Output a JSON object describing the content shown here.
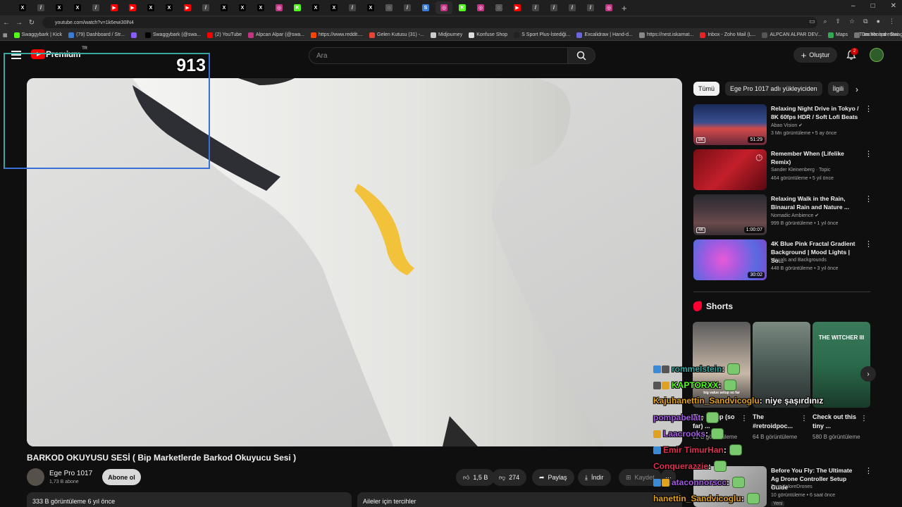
{
  "browser": {
    "tabs": [
      {
        "letter": "X",
        "color": "#000000",
        "active": false
      },
      {
        "letter": "/",
        "color": "#444444",
        "active": false
      },
      {
        "letter": "X",
        "color": "#000000",
        "active": false
      },
      {
        "letter": "X",
        "color": "#000000",
        "active": false
      },
      {
        "letter": "/",
        "color": "#444444",
        "active": false
      },
      {
        "letter": "▶",
        "color": "#ff0000",
        "active": false
      },
      {
        "letter": "▶",
        "color": "#ff0000",
        "active": false
      },
      {
        "letter": "X",
        "color": "#000000",
        "active": false
      },
      {
        "letter": "X",
        "color": "#000000",
        "active": false
      },
      {
        "letter": "▶",
        "color": "#ff0000",
        "active": false
      },
      {
        "letter": "/",
        "color": "#444444",
        "active": false
      },
      {
        "letter": "X",
        "color": "#000000",
        "active": false
      },
      {
        "letter": "X",
        "color": "#000000",
        "active": false
      },
      {
        "letter": "X",
        "color": "#000000",
        "active": false
      },
      {
        "letter": "◎",
        "color": "#c13584",
        "active": false
      },
      {
        "letter": "K",
        "color": "#53fc18",
        "active": false
      },
      {
        "letter": "X",
        "color": "#000000",
        "active": false
      },
      {
        "letter": "X",
        "color": "#000000",
        "active": false
      },
      {
        "letter": "/",
        "color": "#444444",
        "active": false
      },
      {
        "letter": "X",
        "color": "#000000",
        "active": false
      },
      {
        "letter": "◌",
        "color": "#555555",
        "active": false
      },
      {
        "letter": "/",
        "color": "#444444",
        "active": false
      },
      {
        "letter": "S",
        "color": "#3a7bd5",
        "active": false
      },
      {
        "letter": "◎",
        "color": "#c13584",
        "active": true
      },
      {
        "letter": "K",
        "color": "#53fc18",
        "active": false
      },
      {
        "letter": "◎",
        "color": "#c13584",
        "active": false
      },
      {
        "letter": "◌",
        "color": "#555555",
        "active": false
      },
      {
        "letter": "▶",
        "color": "#ff0000",
        "active": false
      },
      {
        "letter": "/",
        "color": "#444444",
        "active": false
      },
      {
        "letter": "/",
        "color": "#444444",
        "active": false
      },
      {
        "letter": "/",
        "color": "#444444",
        "active": false
      },
      {
        "letter": "/",
        "color": "#444444",
        "active": false
      },
      {
        "letter": "◎",
        "color": "#c13584",
        "active": false
      }
    ],
    "new_tab": "+",
    "window_controls": [
      "–",
      "□",
      "✕"
    ],
    "url": "youtube.com/watch?v=1k6ewi30lN4",
    "bookmarks": [
      {
        "label": "Swaggybark | Kick",
        "color": "#53fc18"
      },
      {
        "label": "(79) Dashboard / Str...",
        "color": "#3a7bd5"
      },
      {
        "label": "",
        "color": "#8a5cf6"
      },
      {
        "label": "Swaggybark (@swa...",
        "color": "#000000"
      },
      {
        "label": "(2) YouTube",
        "color": "#ff0000"
      },
      {
        "label": "Alpcan Alpar (@swa...",
        "color": "#c13584"
      },
      {
        "label": "https://www.reddit....",
        "color": "#ff4500"
      },
      {
        "label": "Gelen Kutusu (31) -...",
        "color": "#ea4335"
      },
      {
        "label": "Midjourney",
        "color": "#cccccc"
      },
      {
        "label": "Konfuse Shop",
        "color": "#dddddd"
      },
      {
        "label": "S Sport Plus-İstediği...",
        "color": "#222222"
      },
      {
        "label": "Excalidraw | Hand-d...",
        "color": "#6965db"
      },
      {
        "label": "https://nest.iskarnat...",
        "color": "#888888"
      },
      {
        "label": "Inbox - Zoho Mail (L...",
        "color": "#e42527"
      },
      {
        "label": "ALPCAN ALPAR DEV...",
        "color": "#555555"
      },
      {
        "label": "Maps",
        "color": "#34a853"
      },
      {
        "label": "Dashboard - Swagg...",
        "color": "#777777"
      }
    ],
    "bookmarks_all": "Tüm Yer İşaretleri"
  },
  "header": {
    "logo_text": "Premium",
    "logo_region": "TR",
    "search_placeholder": "Ara",
    "create_label": "Oluştur",
    "notification_count": "2"
  },
  "overlay": {
    "counter": "913"
  },
  "video": {
    "title": "BARKOD OKUYUSU SESİ ( Bip Marketlerde Barkod Okuyucu Sesi )",
    "channel_name": "Ege Pro 1017",
    "subscribers": "1,73 B abone",
    "subscribe_label": "Abone ol",
    "likes": "1,5 B",
    "dislikes": "274",
    "share_label": "Paylaş",
    "download_label": "İndir",
    "save_label": "Kaydet",
    "more_label": "···",
    "views_date": "333 B görüntüleme  6 yıl önce",
    "family_label": "Aileler için tercihler"
  },
  "sidebar": {
    "chips": [
      {
        "label": "Tümü",
        "active": true
      },
      {
        "label": "Ege Pro 1017 adlı yükleyiciden",
        "active": false
      },
      {
        "label": "İlgili",
        "active": false
      }
    ],
    "recommendations": [
      {
        "title": "Relaxing Night Drive in Tokyo / 8K 60fps HDR / Soft Lofi Beats",
        "channel": "Abao Vision ✔",
        "meta": "3 Mn görüntüleme • 5 ay önce",
        "duration": "51:29",
        "badge": "8K",
        "thumb_bg": "linear-gradient(180deg,#1a2a5a 0%,#3a4f8f 45%,#d24a4a 60%,#6a2a3a 100%)"
      },
      {
        "title": "Remember When (Lifelike Remix)",
        "channel": "Sander Kleinenberg · Topic",
        "meta": "464 görüntüleme • 5 yıl önce",
        "duration": "",
        "badge": "",
        "thumb_bg": "linear-gradient(135deg,#7a0d15 0%,#c21f2a 50%,#5a0810 100%)"
      },
      {
        "title": "Relaxing Walk in the Rain, Binaural Rain and Nature ...",
        "channel": "Nomadic Ambience ✔",
        "meta": "999 B görüntüleme • 1 yıl önce",
        "duration": "1:00:07",
        "badge": "4K",
        "thumb_bg": "linear-gradient(180deg,#2a2a30 0%,#4a3a40 40%,#6a4a4a 70%,#3a3035 100%)"
      },
      {
        "title": "4K Blue Pink Fractal Gradient Background | Mood Lights | So...",
        "channel": "Visuals and Backgrounds",
        "meta": "448 B görüntüleme • 3 yıl önce",
        "duration": "30:02",
        "badge": "",
        "thumb_bg": "radial-gradient(circle at 40% 50%,#e85ad8 0%,#a35ae0 35%,#5a6ae0 70%,#7a4ad0 100%)"
      }
    ],
    "shorts_heading": "Shorts",
    "shorts": [
      {
        "title": "The Setup (so far) ...",
        "views": "22 B görüntüleme",
        "thumb_bg": "linear-gradient(180deg,#5a5a5a 0%,#c8b8a8 60%,#3a3a3a 100%)"
      },
      {
        "title": "The #retroidpoc...",
        "views": "64 B görüntüleme",
        "thumb_bg": "linear-gradient(180deg,#7a8a80 0%,#4a5a55 50%,#2a3030 100%)"
      },
      {
        "title": "Check out this tiny ...",
        "views": "580 B görüntüleme",
        "thumb_bg": "linear-gradient(180deg,#3a7a5a 0%,#2a6a4a 50%,#1a3a2a 100%)"
      }
    ],
    "shorts_overlay_texts": [
      "big value setup so far",
      "",
      "THE WITCHER III"
    ],
    "bottom_rec": {
      "title": "Before You Fly: The Ultimate Ag Drone Controller Setup Guide",
      "channel": "TerraXploreDrones",
      "meta": "10 görüntüleme • 6 saat önce",
      "badge": "Yeni",
      "thumb_bg": "linear-gradient(135deg,#c8c8c8 0%,#8a8a8a 100%)"
    }
  },
  "chat": [
    {
      "user": "rommelstein",
      "color": "#3aa6a0",
      "message": "",
      "emote": true,
      "badges": [
        "#3a8ad8",
        "#555555"
      ]
    },
    {
      "user": "KAPTORXX",
      "color": "#53fc18",
      "message": "",
      "emote": true,
      "badges": [
        "#555555",
        "#e0a020"
      ]
    },
    {
      "user": "Kajuhanettin_Sandvicoglu",
      "color": "#e0a020",
      "message": "niye şaşırdınız",
      "emote": false,
      "badges": []
    },
    {
      "user": "pompabelat",
      "color": "#a35ae0",
      "message": "",
      "emote": true,
      "badges": []
    },
    {
      "user": "Laacrooks",
      "color": "#a35ae0",
      "message": "",
      "emote": true,
      "badges": [
        "#e0a020"
      ]
    },
    {
      "user": "Emir TimurHan",
      "color": "#e03050",
      "message": "",
      "emote": true,
      "badges": [
        "#3a8ad8"
      ]
    },
    {
      "user": "Conquerazzie",
      "color": "#e03050",
      "message": "",
      "emote": true,
      "badges": []
    },
    {
      "user": "ataconnorscc",
      "color": "#a35ae0",
      "message": "",
      "emote": true,
      "badges": [
        "#3a8ad8",
        "#e0a020"
      ]
    },
    {
      "user": "hanettin_Sandvicoglu",
      "color": "#e0a020",
      "message": "",
      "emote": true,
      "badges": []
    }
  ]
}
